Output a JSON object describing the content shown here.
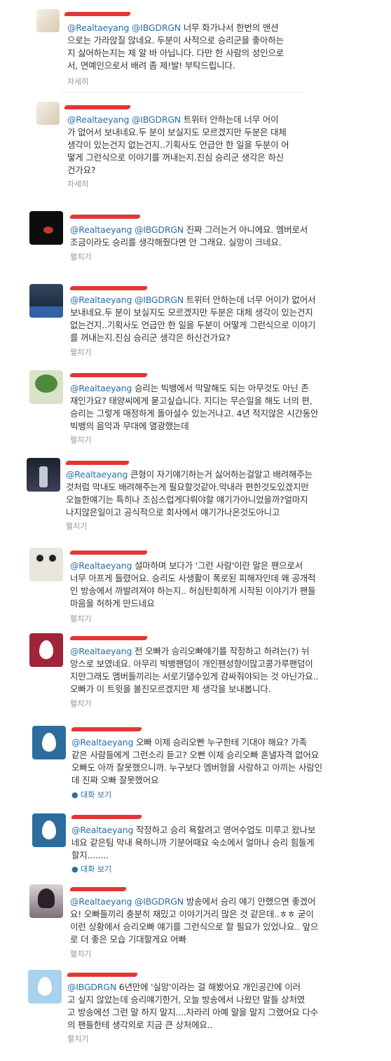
{
  "tweets": [
    {
      "name": "",
      "mentions": "@Realtaeyang @IBGDRGN",
      "body": " 너무 화가나서 한번의 맨션\n으로는 가라앉질 않네요. 두분이 사적으로 승리군을 좋아하는\n지 싫어하는지는 제 알 바 아닙니다. 다만 한 사람의 성인으로\n서, 연예인으로서 배려 좀 제!발! 부탁드립니다.",
      "meta": "자세히"
    },
    {
      "name": "",
      "mentions": "@Realtaeyang @IBGDRGN",
      "body": " 트위터 안하는데 너무 어이\n가 없어서 보내네요.두 분이 보실지도 모르겠지만 두분은 대체\n생각이 있는건지 없는건지..기획사도 언급안 한 일을 두분이 어\n떻게 그런식으로 이야기를 꺼내는지.진심 승리군 생각은 하신\n건가요?",
      "meta": "자세히"
    },
    {
      "name": "",
      "mentions": "@Realtaeyang @IBGDRGN",
      "body": " 진짜 그러는거 아니에요. 멤버로서\n조금이라도 승리를 생각해줬다면 안 그래요. 실망이 크네요.",
      "meta": "펼치기"
    },
    {
      "name": "",
      "mentions": "@Realtaeyang @IBGDRGN",
      "body": " 트위터 안하는데 너무 어이가 없어서\n보내네요.두 분이 보실지도 모르겠지만 두분은 대체 생각이 있는건지\n없는건지..기획사도 언급안 한 일을 두분이 어떻게 그런식으로 이야기\n를 꺼내는지.진심 승리군 생각은 하신건가요?",
      "meta": "펼치기"
    },
    {
      "name": "",
      "mentions": "@Realtaeyang",
      "body": " 승리는 빅뱅에서 막말해도 되는 아무것도 아닌 존\n재인가요? 태양씨에게 묻고싶습니다. 지디는 무슨일을 해도 너의 편,\n승리는 그렇게 매정하게 돌아설수 있는거냐고. 4년 적지않은 시간동안\n빅뱅의 음악과 무대에 열광했는데",
      "meta": "펼치기"
    },
    {
      "name": "",
      "mentions": "@Realtaeyang",
      "body": " 큰형이 자기얘기하는거 싫어하는걸알고 배려해주는\n것처럼 막내도 배려해주는게 필요할것같아.막내라 편한것도있겠지만\n오늘한얘기는 특히나 조심스럽게다뤄야할 얘기가아니었을까?얼마지\n나지않은일이고 공식적으로 회사에서 얘기가나온것도아니고",
      "meta": "펼치기"
    },
    {
      "name": "",
      "mentions": "@Realtaeyang",
      "body": " 설마하며 보다가 '그런 사람'이란 말은 팬으로서\n너무 아프게 들렸어요. 승리도 사생활이 폭로된 피해자인데 왜 공개적\n인 방송에서 까발려져야 하는지.. 허심탄회하게 시작된 이야기가 팬들\n마음을 허하게 만드네요",
      "meta": "펼치기"
    },
    {
      "name": "",
      "mentions": "@Realtaeyang",
      "body": " 전 오빠가 승리오빠얘기를 작정하고 하려는(?) 뉘\n앙스로 보였네요. 아무리 빅뱅팬덤이 개인팬성향이많고콩가루팬덤이\n지만그래도 멤버들끼리는 서로기댈수있게 감싸줘야되는 것 아닌가요..\n오빠가 이 트윗을 볼진모르겠지만 제 생각을 보내봅니다.",
      "meta": "펼치기"
    },
    {
      "name": "",
      "mentions": "@Realtaeyang",
      "body": " 오빠 이제 승리오빤 누구한테 기대야 해요? 가족\n같은 사람들에게 그런소리 듣고? 오빤 이제 승리오빠 혼낼자격 없어요\n오빠도 아까 잘못했으니까. 누구보다 멤버형을 사랑하고 아끼는 사람인\n데 진짜 오빠 잘못했어요",
      "meta": "● 대화 보기"
    },
    {
      "name": "",
      "mentions": "@Realtaeyang",
      "body": " 작정하고 승리 욕할려고 영어수업도 미루고 왔나보\n네요 같은팀 막내 욕하니까 기분어때요 숙소에서 얼마나 승리 힘들게\n할지........",
      "meta": "● 대화 보기"
    },
    {
      "name": "",
      "mentions": "@Realtaeyang @IBGDRGN",
      "body": " 방송에서 승리 얘기 안했으면 좋겠어\n요! 오빠들끼리 충분히 재밌고 이야기거리 많은 것 같은데..ㅎㅎ 굳이\n이런 상황에서 승리오빠 얘기를 그런식으로 할 필요가 있었나요.. 앞으\n로 더 좋은 모습 기대할게요 어빠",
      "meta": "펼치기"
    },
    {
      "name": "",
      "mentions": "@IBGDRGN",
      "body": " 6년만에 '실망'이라는 걸 해봤어요 개인공간에 이러\n고 싶지 않았는데 승리얘기한거, 오늘 방송에서 나왔던 말들 상처였\n고 방송에선 그런 말 하지 말지....차라리 아예 말을 말지 그랬어요 다수\n의 팬들한테 생각외로 지금 큰 상처에요..",
      "meta": "펼치기"
    }
  ]
}
